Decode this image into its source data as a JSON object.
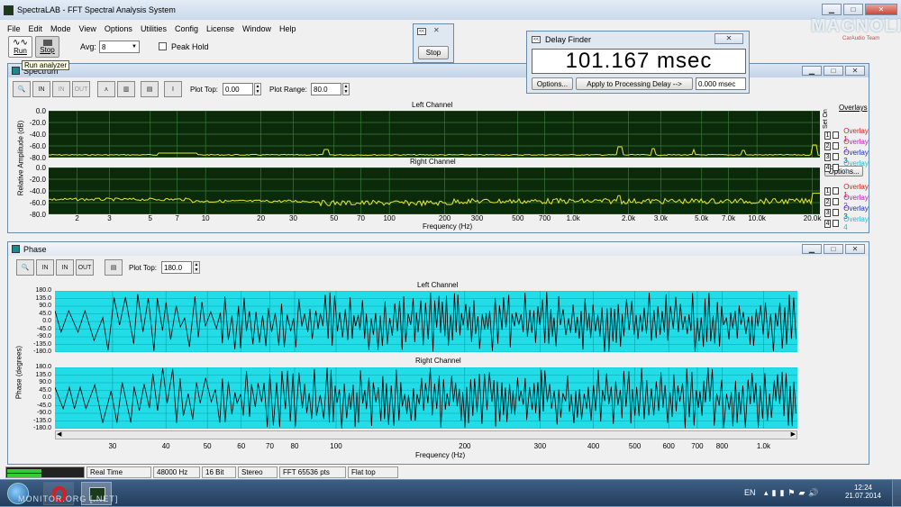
{
  "app": {
    "title": "SpectraLAB - FFT Spectral Analysis System"
  },
  "menu": [
    "File",
    "Edit",
    "Mode",
    "View",
    "Options",
    "Utilities",
    "Config",
    "License",
    "Window",
    "Help"
  ],
  "toolbar": {
    "run_label": "Run",
    "stop_label": "Stop",
    "avg_label": "Avg:",
    "avg_value": "8",
    "peak_hold_label": "Peak Hold",
    "tooltip": "Run analyzer"
  },
  "stop_window": {
    "stop_label": "Stop"
  },
  "delay_finder": {
    "title": "Delay Finder",
    "readout": "101.167 msec",
    "options_label": "Options...",
    "apply_label": "Apply to Processing Delay -->",
    "delay_value": "0.000 msec"
  },
  "watermark": {
    "text": "MAGNOLIA",
    "sub": "CarAudio Team"
  },
  "spectrum": {
    "title": "Spectrum",
    "plot_top_label": "Plot Top:",
    "plot_top_value": "0.00",
    "plot_range_label": "Plot Range:",
    "plot_range_value": "80.0",
    "ylabel": "Relative Amplitude (dB)",
    "left_title": "Left Channel",
    "right_title": "Right Channel",
    "yticks": [
      "0.0",
      "-20.0",
      "-40.0",
      "-60.0",
      "-80.0"
    ],
    "xticks": [
      "2",
      "3",
      "5",
      "7",
      "10",
      "20",
      "30",
      "50",
      "70",
      "100",
      "200",
      "300",
      "500",
      "700",
      "1.0k",
      "2.0k",
      "3.0k",
      "5.0k",
      "7.0k",
      "10.0k",
      "20.0k"
    ],
    "xlabel": "Frequency (Hz)",
    "overlays_title": "Overlays",
    "set_label": "Set",
    "on_label": "On",
    "overlays": [
      {
        "num": "1",
        "name": "Overlay 1",
        "color": "#e02020"
      },
      {
        "num": "2",
        "name": "Overlay 2",
        "color": "#c020c0"
      },
      {
        "num": "3",
        "name": "Overlay 3",
        "color": "#2030c0"
      },
      {
        "num": "4",
        "name": "Overlay 4",
        "color": "#20c0d0"
      }
    ],
    "options_label": "Options...",
    "colors": {
      "bg": "#0a2a0a",
      "grid": "#3a7a3a",
      "trace": "#e8e830"
    }
  },
  "phase": {
    "title": "Phase",
    "plot_top_label": "Plot Top:",
    "plot_top_value": "180.0",
    "ylabel": "Phase (degrees)",
    "left_title": "Left Channel",
    "right_title": "Right Channel",
    "yticks": [
      "180.0",
      "135.0",
      "90.0",
      "45.0",
      "0.0",
      "-45.0",
      "-90.0",
      "-135.0",
      "-180.0"
    ],
    "xticks": [
      "30",
      "40",
      "50",
      "60",
      "70",
      "80",
      "100",
      "200",
      "300",
      "400",
      "500",
      "600",
      "700",
      "800",
      "1.0k"
    ],
    "xlabel": "Frequency (Hz)",
    "colors": {
      "bg": "#22dde8",
      "grid": "#0aa0a8",
      "trace": "#000000"
    }
  },
  "status": [
    "Real Time",
    "48000 Hz",
    "16 Bit",
    "Stereo",
    "FFT 65536 pts",
    "Flat top"
  ],
  "taskbar": {
    "lang": "EN",
    "time": "12:24",
    "date": "21.07.2014",
    "watermark": "MONITOR.ORG [.NET]"
  }
}
